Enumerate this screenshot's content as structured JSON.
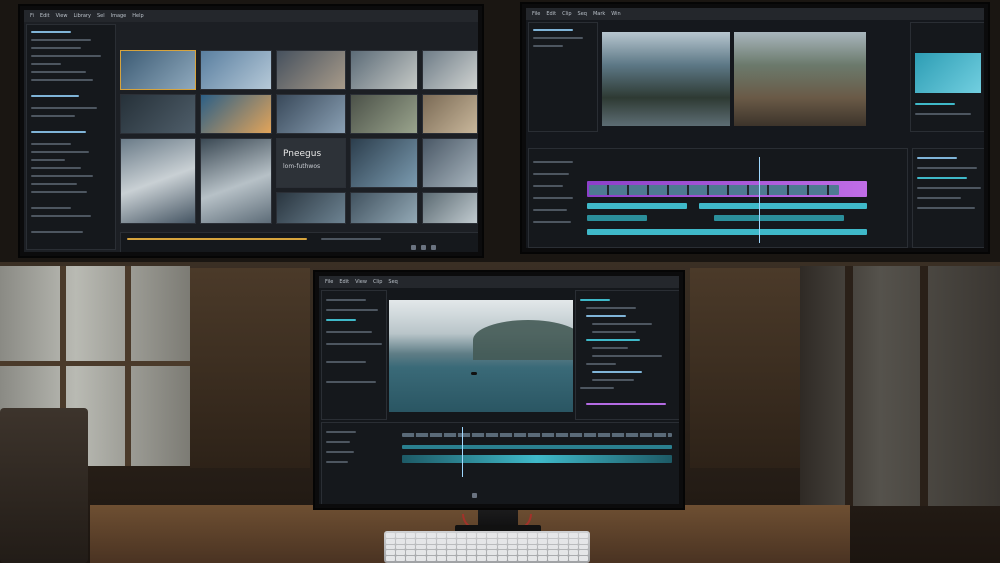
{
  "scene": {
    "description_label": "",
    "colors": {
      "ui_bg": "#1c1f24",
      "accent_cyan": "#3fb9c9",
      "accent_magenta": "#b46be3",
      "accent_gold": "#d7a43d",
      "wood": "#6e4f32"
    }
  },
  "monitor_top_left": {
    "menu": [
      "Fi",
      "Edit",
      "View",
      "Library",
      "Sel",
      "Image",
      "Help"
    ],
    "thumb_text": "Pneegus",
    "thumb_text_2": "lom-futhwos"
  },
  "monitor_top_right": {
    "menu": [
      "File",
      "Edit",
      "Clip",
      "Seq",
      "Mark",
      "Win"
    ]
  },
  "monitor_center": {
    "menu": [
      "File",
      "Edit",
      "View",
      "Clip",
      "Seq"
    ]
  },
  "icons": [
    "play-icon",
    "folder-icon",
    "timeline-icon",
    "settings-icon"
  ]
}
